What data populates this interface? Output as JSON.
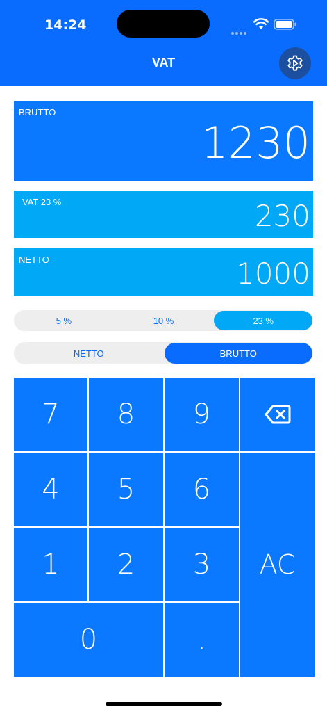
{
  "status_bar": {
    "time": "14:24"
  },
  "header": {
    "title": "VAT"
  },
  "displays": {
    "brutto": {
      "label": "BRUTTO",
      "value": "1230"
    },
    "vat": {
      "label": "VAT 23 %",
      "value": "230"
    },
    "netto": {
      "label": "NETTO",
      "value": "1000"
    }
  },
  "rates": [
    {
      "label": "5 %"
    },
    {
      "label": "10 %"
    },
    {
      "label": "23 %",
      "selected": true
    }
  ],
  "modes": [
    {
      "label": "NETTO"
    },
    {
      "label": "BRUTTO",
      "selected": true
    }
  ],
  "keypad": {
    "k7": "7",
    "k8": "8",
    "k9": "9",
    "k4": "4",
    "k5": "5",
    "k6": "6",
    "k1": "1",
    "k2": "2",
    "k3": "3",
    "k0": "0",
    "dot": ".",
    "clear": "AC"
  },
  "icons": {
    "settings": "gear-icon",
    "backspace": "backspace-icon"
  },
  "colors": {
    "header": "#0a6cff",
    "primary_display": "#0a78ff",
    "secondary_display": "#00a8f6",
    "segment_bg": "#eeeeee",
    "settings_button": "#1c4f9f"
  }
}
